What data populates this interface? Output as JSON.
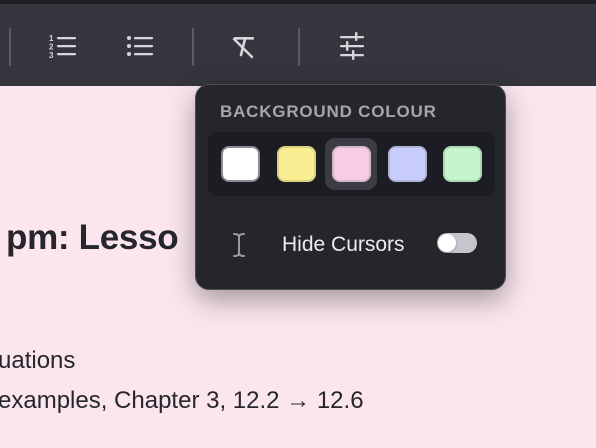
{
  "toolbar": {
    "buttons": [
      {
        "name": "numbered-list-icon"
      },
      {
        "name": "bullet-list-icon"
      },
      {
        "name": "clear-formatting-icon"
      },
      {
        "name": "sliders-icon"
      }
    ]
  },
  "document": {
    "heading": "pm: Lesso",
    "line1": "uations",
    "line2": "examples, Chapter 3, 12.2 → 12.6"
  },
  "popover": {
    "title": "BACKGROUND COLOUR",
    "swatches": [
      {
        "name": "white",
        "color": "#ffffff",
        "selected": false
      },
      {
        "name": "yellow",
        "color": "#f9ee92",
        "selected": false
      },
      {
        "name": "pink",
        "color": "#f6cde3",
        "selected": true
      },
      {
        "name": "blue",
        "color": "#c9cdfc",
        "selected": false
      },
      {
        "name": "green",
        "color": "#c6f4cd",
        "selected": false
      }
    ],
    "hide_cursors_label": "Hide Cursors",
    "hide_cursors_on": false
  },
  "colors": {
    "page_background": "#fbe6ee",
    "toolbar_background": "#34353d",
    "popover_background": "#25262c"
  }
}
